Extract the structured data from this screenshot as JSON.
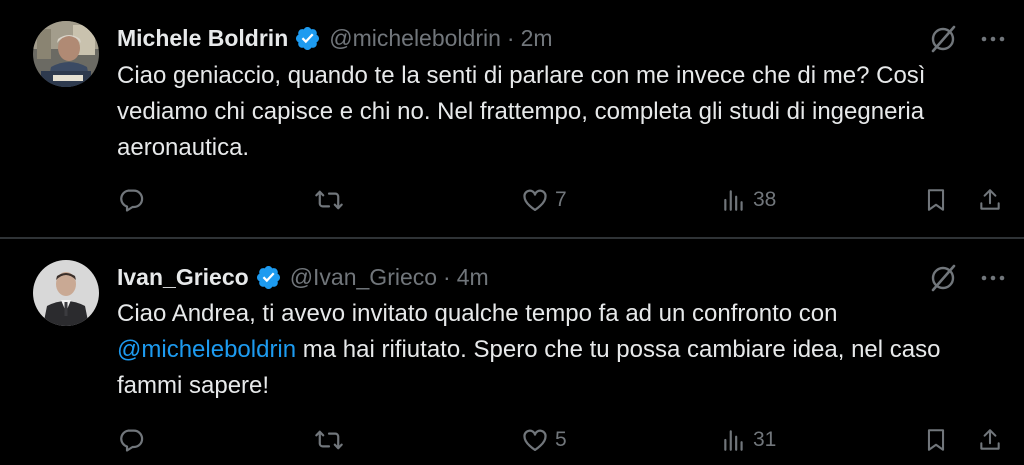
{
  "tweets": [
    {
      "author": "Michele Boldrin",
      "handle": "@micheleboldrin",
      "separator": "·",
      "time": "2m",
      "text": "Ciao geniaccio, quando te la senti di parlare con me invece che di me? Così vediamo chi capisce e chi no. Nel frattempo, completa gli studi di ingegneria aeronautica.",
      "likes": "7",
      "views": "38"
    },
    {
      "author": "Ivan_Grieco",
      "handle": "@Ivan_Grieco",
      "separator": "·",
      "time": "4m",
      "text_before": "Ciao Andrea, ti avevo invitato qualche tempo fa ad un confronto con ",
      "mention": "@micheleboldrin",
      "text_after": " ma hai rifiutato. Spero che tu possa cambiare idea, nel caso fammi sapere!",
      "likes": "5",
      "views": "31"
    }
  ],
  "icons": {
    "verified": "verified-badge-icon",
    "grok": "grok-icon",
    "more": "more-icon",
    "reply": "reply-icon",
    "retweet": "retweet-icon",
    "like": "like-icon",
    "views": "views-icon",
    "bookmark": "bookmark-icon",
    "share": "share-icon"
  },
  "colors": {
    "background": "#000000",
    "text": "#e7e9ea",
    "secondary": "#71767b",
    "accent": "#1d9bf0",
    "divider": "#2f3336"
  }
}
